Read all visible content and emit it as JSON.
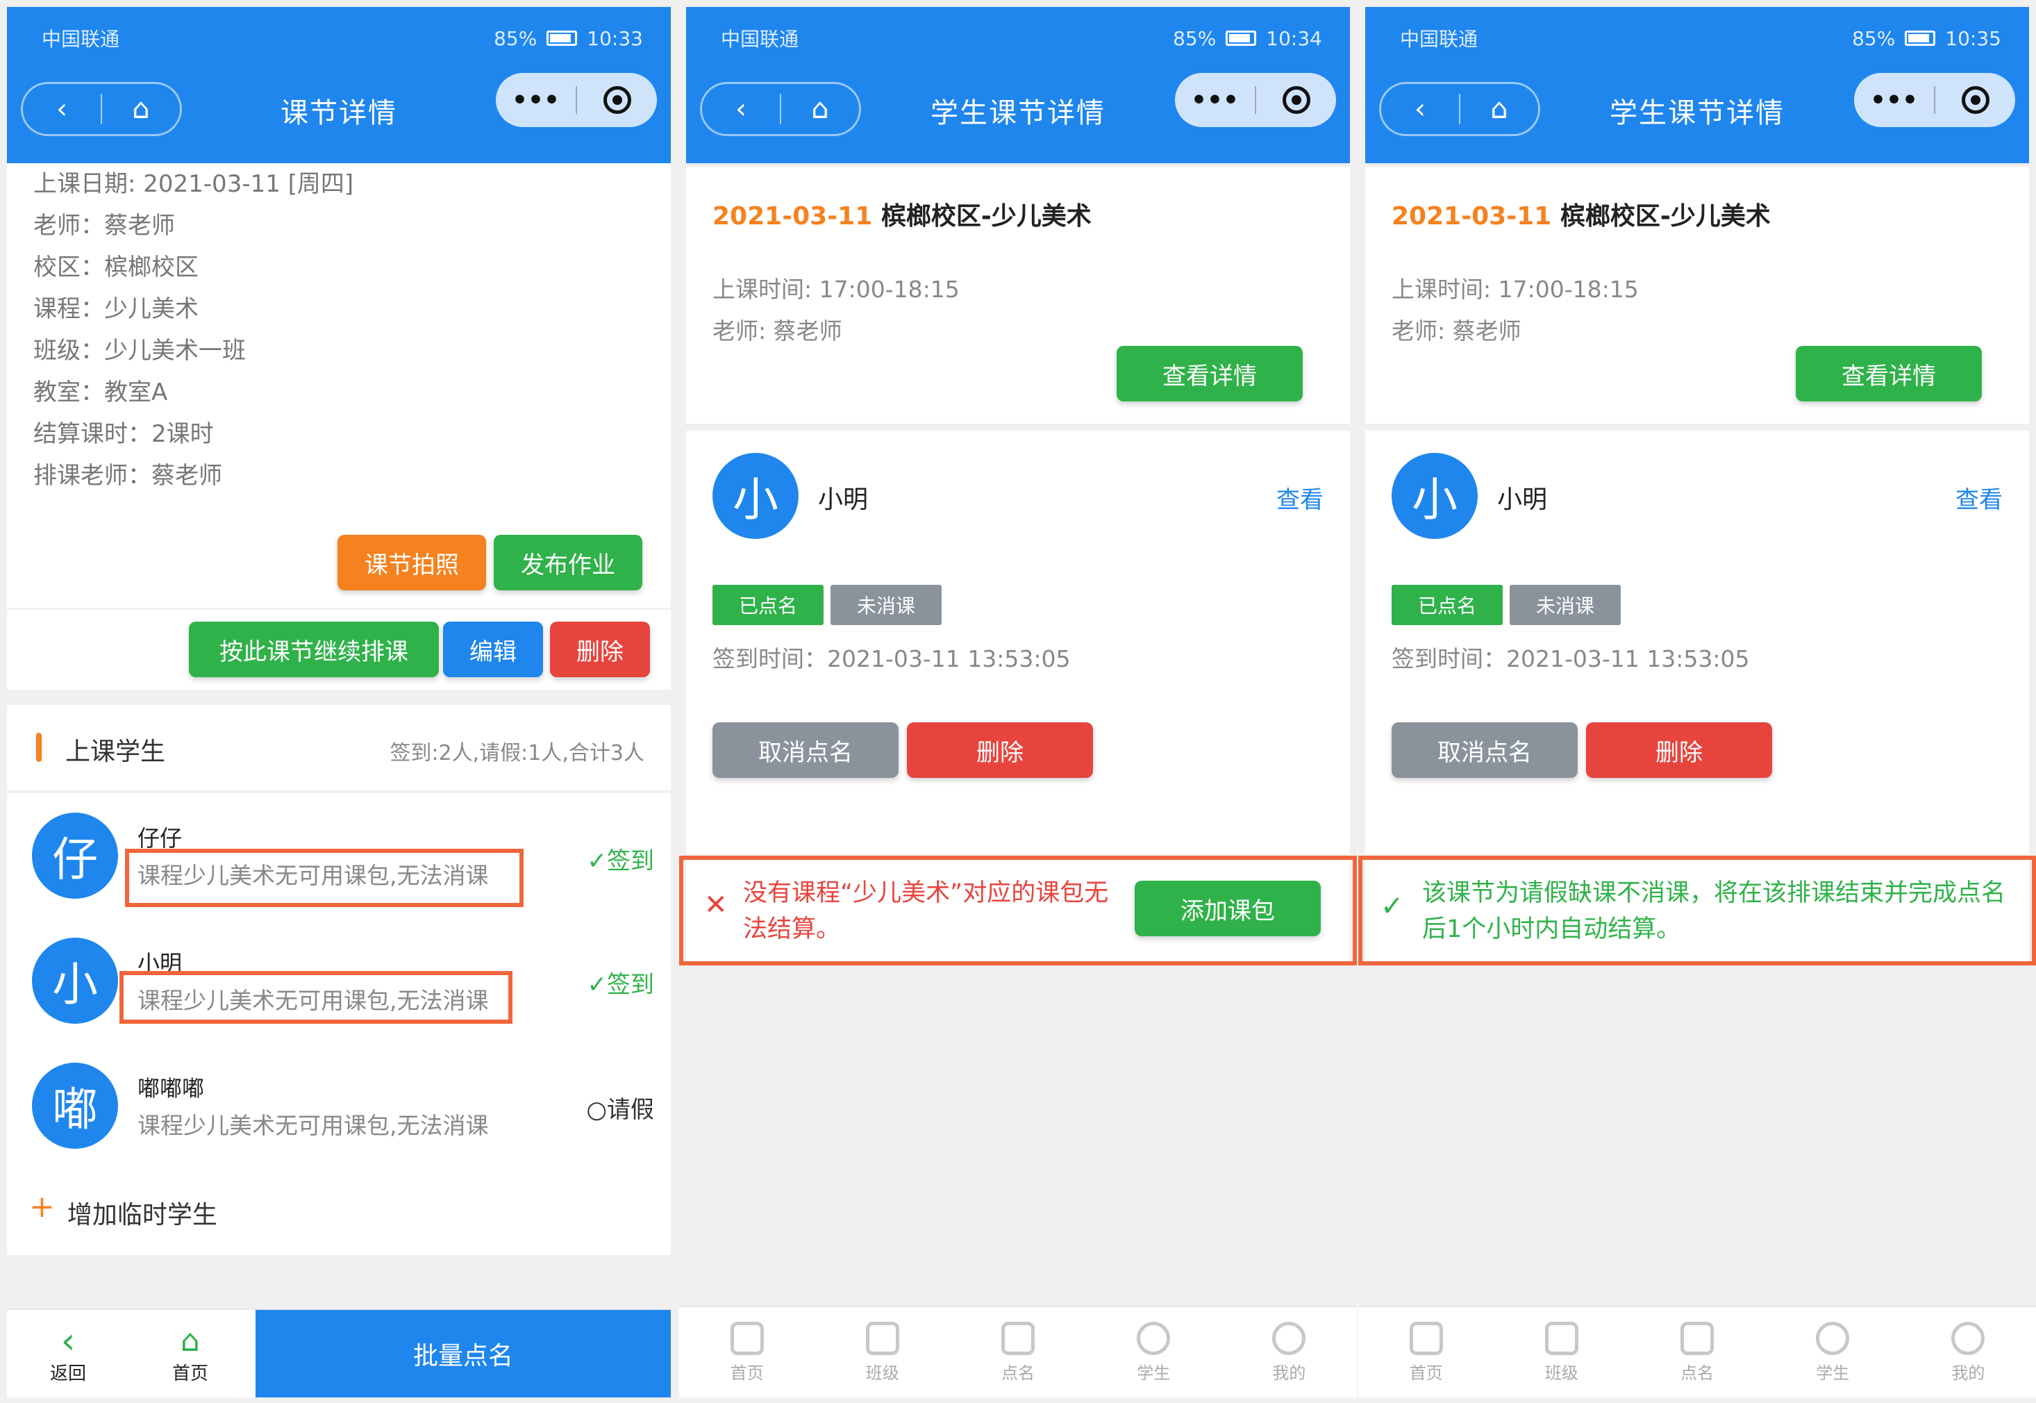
{
  "status": [
    {
      "carrier": "中国联通",
      "battery": "85%",
      "time": "10:33"
    },
    {
      "carrier": "中国联通",
      "battery": "85%",
      "time": "10:34"
    },
    {
      "carrier": "中国联通",
      "battery": "85%",
      "time": "10:35"
    }
  ],
  "nav": {
    "back_icon": "‹",
    "home_icon": "⌂",
    "more_icon": "•••"
  },
  "p1": {
    "title": "课节详情",
    "info": [
      "上课日期: 2021-03-11 [周四]",
      "老师：蔡老师",
      "校区：槟榔校区",
      "课程：少儿美术",
      "班级：少儿美术一班",
      "教室：教室A",
      "结算课时：2课时",
      "排课老师：蔡老师"
    ],
    "btn_photo": "课节拍照",
    "btn_homework": "发布作业",
    "btn_continue": "按此课节继续排课",
    "btn_edit": "编辑",
    "btn_delete": "删除",
    "students_title": "上课学生",
    "students_summary": "签到:2人,请假:1人,合计3人",
    "students": [
      {
        "avatar": "仔",
        "name": "仔仔",
        "note": "课程少儿美术无可用课包,无法消课",
        "status": "✓签到"
      },
      {
        "avatar": "小",
        "name": "小明",
        "note": "课程少儿美术无可用课包,无法消课",
        "status": "✓签到"
      },
      {
        "avatar": "嘟",
        "name": "嘟嘟嘟",
        "note": "课程少儿美术无可用课包,无法消课",
        "status": "○请假"
      }
    ],
    "add_temp": "增加临时学生",
    "bottom_back": "返回",
    "bottom_home": "首页",
    "bottom_batch": "批量点名"
  },
  "p2": {
    "title": "学生课节详情",
    "date": "2021-03-11",
    "campus": "槟榔校区-少儿美术",
    "time": "上课时间: 17:00-18:15",
    "teacher": "老师: 蔡老师",
    "btn_detail": "查看详情",
    "student_avatar": "小",
    "student_name": "小明",
    "view": "查看",
    "tag_called": "已点名",
    "tag_unsettled": "未消课",
    "checkin": "签到时间：2021-03-11 13:53:05",
    "btn_cancel": "取消点名",
    "btn_delete": "删除",
    "alert": "没有课程“少儿美术”对应的课包无法结算。",
    "btn_add_pkg": "添加课包"
  },
  "p3": {
    "title": "学生课节详情",
    "date": "2021-03-11",
    "campus": "槟榔校区-少儿美术",
    "time": "上课时间: 17:00-18:15",
    "teacher": "老师: 蔡老师",
    "btn_detail": "查看详情",
    "student_avatar": "小",
    "student_name": "小明",
    "view": "查看",
    "tag_called": "已点名",
    "tag_unsettled": "未消课",
    "checkin": "签到时间：2021-03-11 13:53:05",
    "btn_cancel": "取消点名",
    "btn_delete": "删除",
    "alert": "该课节为请假缺课不消课，将在该排课结束并完成点名后1个小时内自动结算。"
  },
  "tabs": [
    "首页",
    "班级",
    "点名",
    "学生",
    "我的"
  ],
  "colors": {
    "primary": "#1f86ee",
    "green": "#30b24a",
    "orange": "#f5821f",
    "red": "#e8443e",
    "highlight": "#f0663a"
  }
}
